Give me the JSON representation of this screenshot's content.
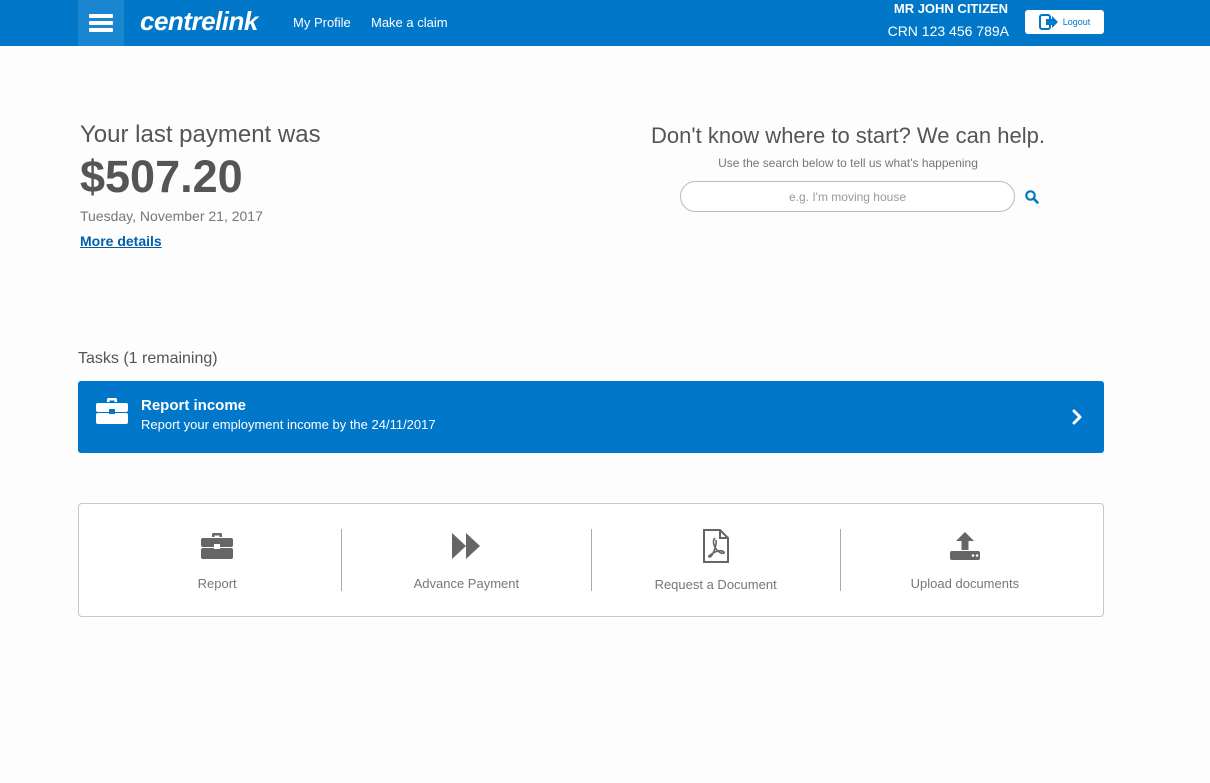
{
  "header": {
    "brand": "centrelink",
    "nav": [
      {
        "label": "My Profile"
      },
      {
        "label": "Make a claim"
      }
    ],
    "user_name": "MR JOHN CITIZEN",
    "user_crn": "CRN 123 456 789A",
    "logout_label": "Logout",
    "brand_color": "#0077c8"
  },
  "payment": {
    "heading": "Your last payment was",
    "amount": "$507.20",
    "date": "Tuesday, November 21, 2017",
    "details_link": "More details"
  },
  "help": {
    "heading": "Don't know where to start? We can help.",
    "subtitle": "Use the search below to tell us what's happening",
    "search_placeholder": "e.g. I'm moving house",
    "search_icon": "search-icon"
  },
  "tasks": {
    "heading": "Tasks (1 remaining)",
    "items": [
      {
        "title": "Report income",
        "description": "Report your employment income by the 24/11/2017",
        "icon": "briefcase-icon"
      }
    ]
  },
  "quick_links": [
    {
      "label": "Report",
      "icon": "briefcase-icon"
    },
    {
      "label": "Advance Payment",
      "icon": "fast-forward-icon"
    },
    {
      "label": "Request a Document",
      "icon": "pdf-document-icon"
    },
    {
      "label": "Upload documents",
      "icon": "upload-icon"
    }
  ]
}
